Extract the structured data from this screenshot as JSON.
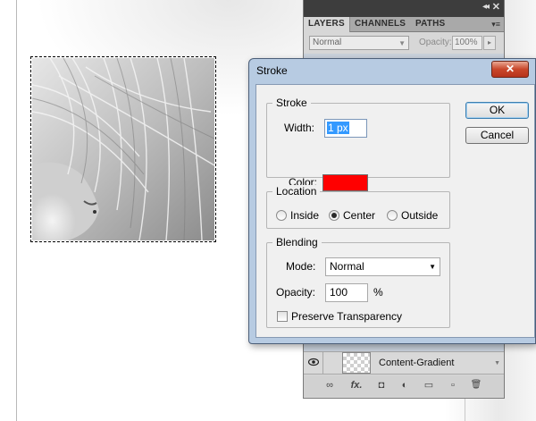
{
  "layers_panel": {
    "tabs": [
      {
        "label": "LAYERS",
        "active": true
      },
      {
        "label": "CHANNELS",
        "active": false
      },
      {
        "label": "PATHS",
        "active": false
      }
    ],
    "collapse_glyph": "◂◂",
    "close_glyph": "✕",
    "menu_glyph": "▾≡",
    "blend_mode": "Normal",
    "opacity_label": "Opacity:",
    "opacity_value": "100%",
    "layer": {
      "name": "Content-Gradient",
      "visible": true
    },
    "footer_icons": [
      "link-icon",
      "fx-icon",
      "mask-icon",
      "adjustment-icon",
      "folder-icon",
      "new-layer-icon",
      "trash-icon"
    ],
    "footer_glyphs": {
      "link": "∞",
      "fx": "fx.",
      "mask": "◘",
      "adjustment": "◐",
      "folder": "▭",
      "new_layer": "▫",
      "trash": "🗑"
    }
  },
  "dialog": {
    "title": "Stroke",
    "close_glyph": "✕",
    "stroke_group": {
      "label": "Stroke",
      "width_label": "Width:",
      "width_value": "1 px",
      "color_label": "Color:",
      "color": "#ff0000"
    },
    "location_group": {
      "label": "Location",
      "options": [
        {
          "label": "Inside",
          "checked": false
        },
        {
          "label": "Center",
          "checked": true
        },
        {
          "label": "Outside",
          "checked": false
        }
      ]
    },
    "blending_group": {
      "label": "Blending",
      "mode_label": "Mode:",
      "mode_value": "Normal",
      "opacity_label": "Opacity:",
      "opacity_value": "100",
      "opacity_unit": "%",
      "preserve_label": "Preserve Transparency",
      "preserve_checked": false
    },
    "ok_label": "OK",
    "cancel_label": "Cancel"
  },
  "colors": {
    "panel_titlebar": "#3d3d3d",
    "dialog_frame": "#b7cbe2",
    "stroke_color": "#ff0000",
    "selection": "#3399ff"
  }
}
